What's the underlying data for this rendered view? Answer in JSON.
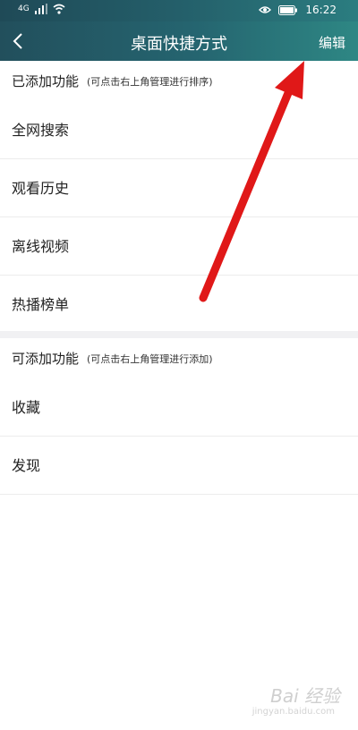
{
  "status_bar": {
    "time": "16:22",
    "signal": "4G"
  },
  "header": {
    "title": "桌面快捷方式",
    "edit_label": "编辑"
  },
  "added_section": {
    "title": "已添加功能",
    "hint": "(可点击右上角管理进行排序)",
    "items": [
      "全网搜索",
      "观看历史",
      "离线视频",
      "热播榜单"
    ]
  },
  "available_section": {
    "title": "可添加功能",
    "hint": "(可点击右上角管理进行添加)",
    "items": [
      "收藏",
      "发现"
    ]
  },
  "watermark": {
    "line1": "Bai 经验",
    "line2": "jingyan.baidu.com"
  },
  "colors": {
    "header_start": "#224f5c",
    "header_end": "#2e8784",
    "annotation_arrow": "#e01818"
  }
}
